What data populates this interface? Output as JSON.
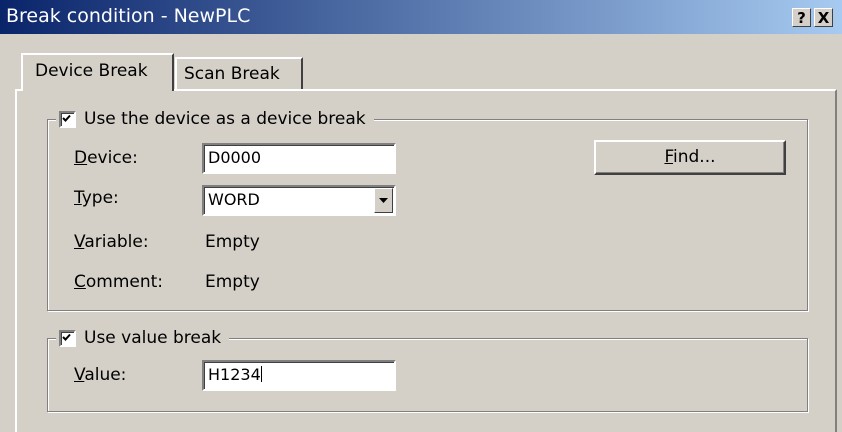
{
  "window": {
    "title": "Break condition - NewPLC",
    "help_button": "?",
    "close_button": "X"
  },
  "tabs": [
    {
      "label": "Device Break",
      "active": true
    },
    {
      "label": "Scan Break",
      "active": false
    }
  ],
  "device_group": {
    "checkbox_label": "Use the device as a device break",
    "checked": true,
    "device": {
      "label_key": "D",
      "label_rest": "evice:",
      "value": "D0000"
    },
    "type": {
      "label_key": "T",
      "label_rest": "ype:",
      "selected": "WORD"
    },
    "variable": {
      "label_key": "V",
      "label_rest": "ariable:",
      "value": "Empty"
    },
    "comment": {
      "label_key": "C",
      "label_rest": "omment:",
      "value": "Empty"
    },
    "find_button": {
      "label_key": "F",
      "label_rest": "ind..."
    }
  },
  "value_group": {
    "checkbox_label": "Use value break",
    "checked": true,
    "value": {
      "label_key": "V",
      "label_rest": "alue:",
      "value": "H1234"
    }
  }
}
